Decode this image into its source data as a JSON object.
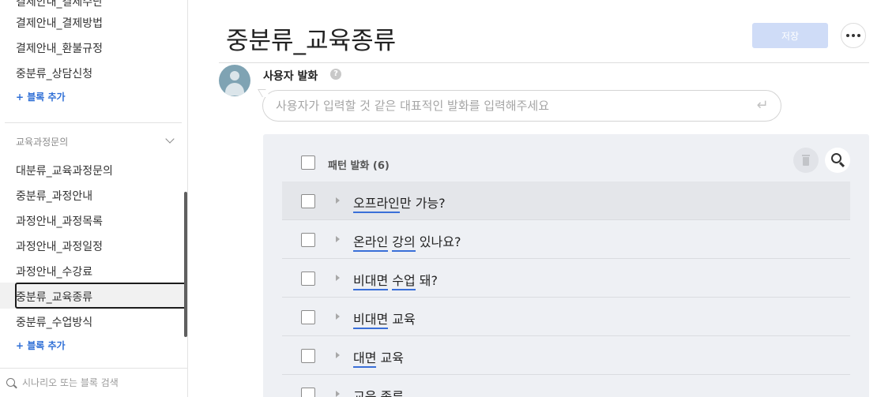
{
  "sidebar": {
    "top_items": [
      {
        "label": "결제안내_결제방법"
      },
      {
        "label": "결제안내_환불규정"
      },
      {
        "label": "중분류_상담신청"
      }
    ],
    "add_block_label_1": "+ 블록 추가",
    "group_label": "교육과정문의",
    "group_items": [
      {
        "label": "대분류_교육과정문의"
      },
      {
        "label": "중분류_과정안내"
      },
      {
        "label": "과정안내_과정목록"
      },
      {
        "label": "과정안내_과정일정"
      },
      {
        "label": "과정안내_수강료"
      },
      {
        "label": "중분류_교육종류"
      },
      {
        "label": "중분류_수업방식"
      }
    ],
    "selected_label": "중분류_교육종류",
    "add_block_label_2": "+ 블록 추가",
    "search_placeholder": "시나리오 또는 블록 검색"
  },
  "main": {
    "title": "중분류_교육종류",
    "save_label": "저장",
    "user_utterance_label": "사용자 발화",
    "help_glyph": "?",
    "utterance_placeholder": "사용자가 입력할 것 같은 대표적인 발화를 입력해주세요",
    "enter_glyph": "↵",
    "pattern_header": "패턴 발화 (6)",
    "patterns": [
      {
        "tokens": [
          {
            "t": "오프라인",
            "u": true
          },
          {
            "t": "만 가능?",
            "u": false
          }
        ]
      },
      {
        "tokens": [
          {
            "t": "온라인",
            "u": true
          },
          {
            "t": " ",
            "u": false
          },
          {
            "t": "강의",
            "u": true
          },
          {
            "t": " 있나요?",
            "u": false
          }
        ]
      },
      {
        "tokens": [
          {
            "t": "비대면",
            "u": true
          },
          {
            "t": " ",
            "u": false
          },
          {
            "t": "수업",
            "u": true
          },
          {
            "t": " 돼?",
            "u": false
          }
        ]
      },
      {
        "tokens": [
          {
            "t": "비대면",
            "u": true
          },
          {
            "t": " 교육",
            "u": false
          }
        ]
      },
      {
        "tokens": [
          {
            "t": "대면",
            "u": true
          },
          {
            "t": " 교육",
            "u": false
          }
        ]
      },
      {
        "tokens": [
          {
            "t": "교육 종류",
            "u": false
          }
        ]
      }
    ]
  },
  "colors": {
    "accent": "#2f6fd6",
    "save_disabled": "#cfdcf7",
    "panel_bg": "#eef0f4",
    "token_underline": "#3a6fd8"
  }
}
